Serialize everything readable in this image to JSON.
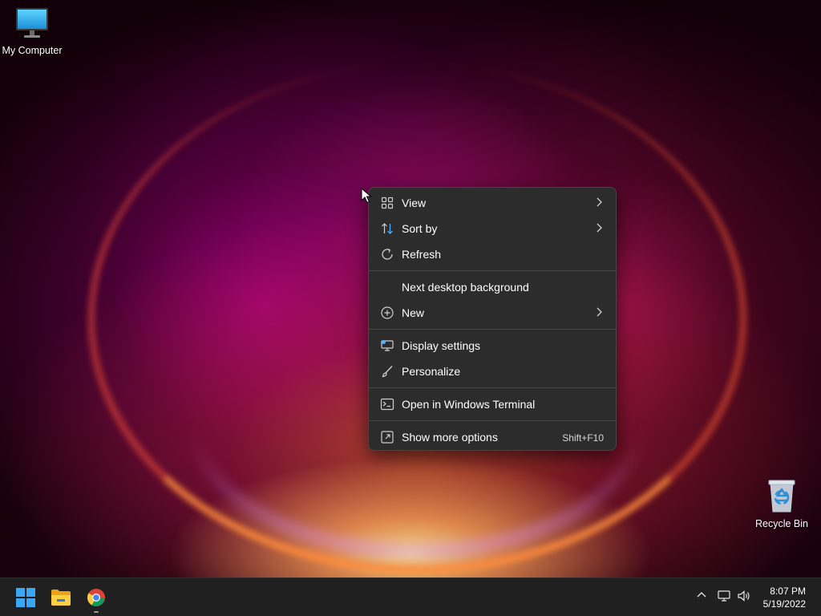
{
  "desktop": {
    "icons": [
      {
        "label": "My Computer",
        "icon": "monitor-icon"
      },
      {
        "label": "Recycle Bin",
        "icon": "recycle-bin-icon"
      }
    ]
  },
  "context_menu": {
    "items": [
      {
        "label": "View",
        "icon": "grid-view-icon",
        "submenu": true
      },
      {
        "label": "Sort by",
        "icon": "sort-icon",
        "submenu": true
      },
      {
        "label": "Refresh",
        "icon": "refresh-icon",
        "submenu": false
      },
      {
        "label": "Next desktop background",
        "icon": "",
        "submenu": false
      },
      {
        "label": "New",
        "icon": "new-plus-icon",
        "submenu": true
      },
      {
        "label": "Display settings",
        "icon": "display-settings-icon",
        "submenu": false
      },
      {
        "label": "Personalize",
        "icon": "brush-icon",
        "submenu": false
      },
      {
        "label": "Open in Windows Terminal",
        "icon": "terminal-icon",
        "submenu": false
      },
      {
        "label": "Show more options",
        "icon": "more-options-icon",
        "shortcut": "Shift+F10"
      }
    ]
  },
  "taskbar": {
    "apps": [
      {
        "name": "start-button",
        "icon": "windows-logo-icon"
      },
      {
        "name": "file-explorer",
        "icon": "folder-icon"
      },
      {
        "name": "chrome",
        "icon": "chrome-icon"
      }
    ],
    "tray_icons": [
      "chevron-up-icon",
      "network-icon",
      "volume-icon"
    ],
    "clock": {
      "time": "8:07 PM",
      "date": "5/19/2022"
    }
  },
  "colors": {
    "menu_bg": "#2c2c2c",
    "menu_text": "#ffffff",
    "taskbar_bg": "#202020",
    "accent": "#0078d4"
  }
}
